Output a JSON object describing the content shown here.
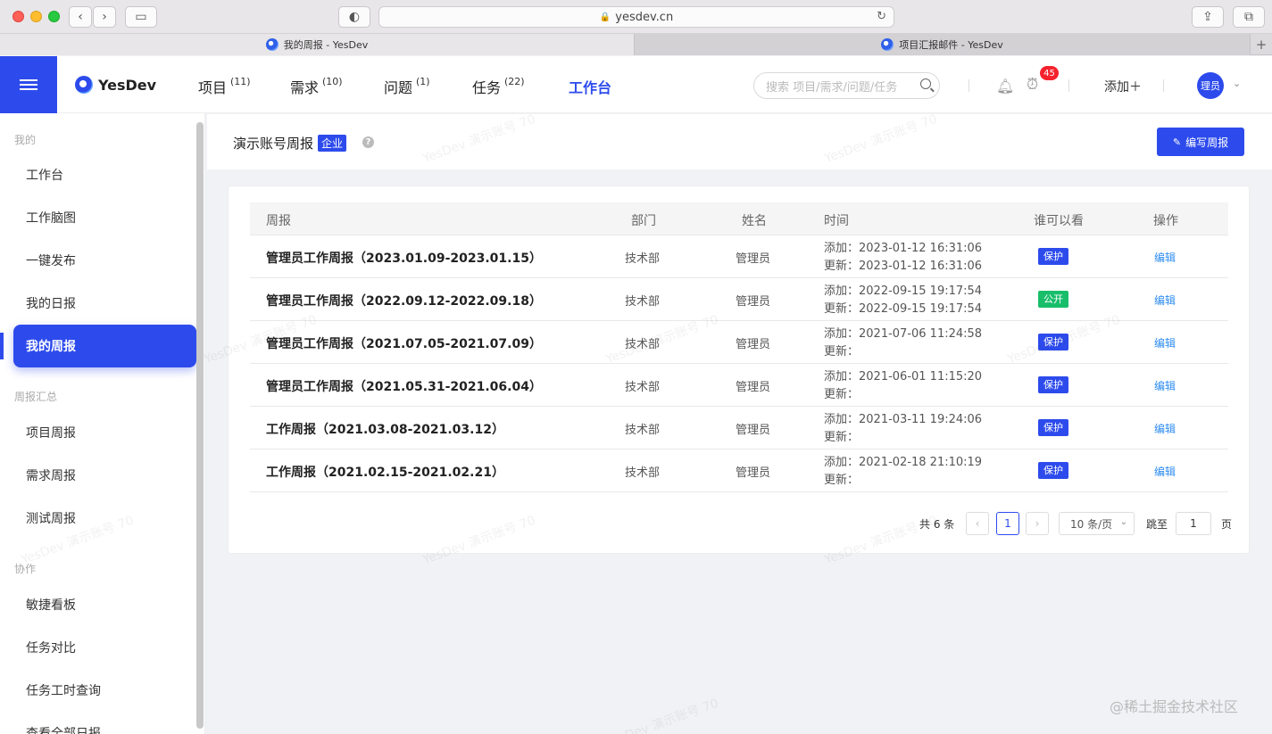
{
  "browser": {
    "url": "yesdev.cn",
    "tabs": [
      {
        "title": "我的周报 - YesDev"
      },
      {
        "title": "项目汇报邮件 - YesDev"
      }
    ],
    "new_tab": "+"
  },
  "header": {
    "logo": "YesDev",
    "nav": [
      {
        "label": "项目",
        "count": "(11)"
      },
      {
        "label": "需求",
        "count": "(10)"
      },
      {
        "label": "问题",
        "count": "(1)"
      },
      {
        "label": "任务",
        "count": "(22)"
      },
      {
        "label": "工作台",
        "count": ""
      }
    ],
    "search_placeholder": "搜索 项目/需求/问题/任务",
    "alarm_badge": "45",
    "add_label": "添加＋",
    "avatar_text": "理员"
  },
  "sidebar": {
    "groups": [
      "我的",
      "周报汇总",
      "协作"
    ],
    "items": [
      "工作台",
      "工作脑图",
      "一键发布",
      "我的日报",
      "我的周报",
      "项目周报",
      "需求周报",
      "测试周报",
      "敏捷看板",
      "任务对比",
      "任务工时查询",
      "查看全部日报"
    ]
  },
  "page": {
    "title": "演示账号周报",
    "tag": "企业",
    "help": "?",
    "write_button": "编写周报"
  },
  "table": {
    "headers": [
      "周报",
      "部门",
      "姓名",
      "时间",
      "谁可以看",
      "操作"
    ],
    "rows": [
      {
        "title": "管理员工作周报（2023.01.09-2023.01.15）",
        "dept": "技术部",
        "name": "管理员",
        "added": "添加：2023-01-12 16:31:06",
        "updated": "更新：2023-01-12 16:31:06",
        "vis": "保护",
        "op": "编辑"
      },
      {
        "title": "管理员工作周报（2022.09.12-2022.09.18）",
        "dept": "技术部",
        "name": "管理员",
        "added": "添加：2022-09-15 19:17:54",
        "updated": "更新：2022-09-15 19:17:54",
        "vis": "公开",
        "op": "编辑"
      },
      {
        "title": "管理员工作周报（2021.07.05-2021.07.09）",
        "dept": "技术部",
        "name": "管理员",
        "added": "添加：2021-07-06 11:24:58",
        "updated": "更新：",
        "vis": "保护",
        "op": "编辑"
      },
      {
        "title": "管理员工作周报（2021.05.31-2021.06.04）",
        "dept": "技术部",
        "name": "管理员",
        "added": "添加：2021-06-01 11:15:20",
        "updated": "更新：",
        "vis": "保护",
        "op": "编辑"
      },
      {
        "title": "工作周报（2021.03.08-2021.03.12）",
        "dept": "技术部",
        "name": "管理员",
        "added": "添加：2021-03-11 19:24:06",
        "updated": "更新：",
        "vis": "保护",
        "op": "编辑"
      },
      {
        "title": "工作周报（2021.02.15-2021.02.21）",
        "dept": "技术部",
        "name": "管理员",
        "added": "添加：2021-02-18 21:10:19",
        "updated": "更新：",
        "vis": "保护",
        "op": "编辑"
      }
    ]
  },
  "pagination": {
    "total": "共 6 条",
    "prev": "‹",
    "current": "1",
    "next": "›",
    "page_size": "10 条/页",
    "jump_label": "跳至",
    "jump_value": "1",
    "unit": "页"
  },
  "watermark": "YesDev 演示账号 70",
  "credit": "@稀土掘金技术社区"
}
